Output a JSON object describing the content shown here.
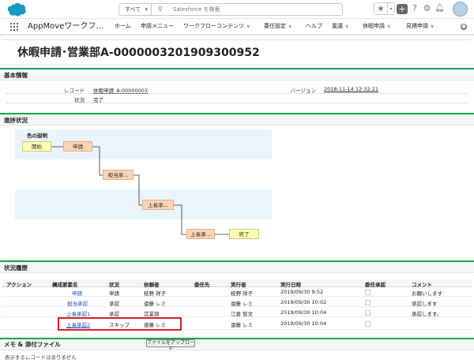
{
  "topbar": {
    "search_scope": "すべて",
    "search_placeholder": "Salesforce を検索",
    "icons": [
      "salesforce-logo",
      "search-icon",
      "star-icon",
      "plus-icon",
      "help-icon",
      "gear-icon",
      "bell-icon",
      "avatar"
    ]
  },
  "nav": {
    "app_name": "AppMoveワークフ...",
    "items": [
      {
        "label": "ホーム",
        "dropdown": false
      },
      {
        "label": "申請メニュー",
        "dropdown": false
      },
      {
        "label": "ワークフローコンテンツ",
        "dropdown": true
      },
      {
        "label": "委任設定",
        "dropdown": true
      },
      {
        "label": "ヘルプ",
        "dropdown": false
      },
      {
        "label": "稟議",
        "dropdown": true
      },
      {
        "label": "休暇申請",
        "dropdown": true
      },
      {
        "label": "見積申請",
        "dropdown": true
      }
    ],
    "dropdown_icon": "chevron-down-icon"
  },
  "page": {
    "title": "休暇申請･営業部A-0000003201909300952"
  },
  "basic_info": {
    "section_title": "基本情報",
    "record_label": "レコード",
    "record_value": "休暇申請_A-00000003",
    "status_label": "状況",
    "status_value": "完了",
    "version_label": "バージョン",
    "version_value": "2018-11-14 12:32:21"
  },
  "progress": {
    "section_title": "進捗状況",
    "legend_title": "色の説明",
    "nodes": {
      "start": "開始",
      "apply": "申請",
      "tanto": "担当承...",
      "joucho1": "上長承...",
      "joucho2": "上長承...",
      "end": "終了"
    }
  },
  "history": {
    "section_title": "状況履歴",
    "headers": [
      "アクション",
      "構成要素名",
      "状況",
      "依頼者",
      "委任先",
      "実行者",
      "実行日時",
      "委任承認",
      "コメント"
    ],
    "rows": [
      {
        "component": "申請",
        "status": "申請",
        "requester": "枝野 祥子",
        "delegate": "",
        "executor": "枝野 祥子",
        "datetime": "2019/09/30 9:52",
        "comment": "お願いします"
      },
      {
        "component": "担当承認",
        "status": "承認",
        "requester": "遠藤 レミ",
        "delegate": "",
        "executor": "遠藤 レミ",
        "datetime": "2019/09/30 10:02",
        "comment": "承認します"
      },
      {
        "component": "上長承認1",
        "status": "承認",
        "requester": "営業部",
        "delegate": "",
        "executor": "江倉 智文",
        "datetime": "2019/09/30 10:04",
        "comment": "承認します。"
      },
      {
        "component": "上長承認2",
        "status": "スキップ",
        "requester": "遠藤 レミ",
        "delegate": "",
        "executor": "遠藤 レミ",
        "datetime": "2019/09/30 10:04",
        "comment": ""
      }
    ]
  },
  "memo": {
    "section_title": "メモ & 添付ファイル",
    "upload_button": "ファイルをアップロード",
    "empty_text": "表示するレコードはありません"
  },
  "colors": {
    "section_accent": "#1ba34d",
    "link": "#1a46c9",
    "highlight": "#d42020",
    "node_start_end": "#ffffb3",
    "node_step": "#fcd5b4",
    "flow_band": "#eaf4fb"
  }
}
